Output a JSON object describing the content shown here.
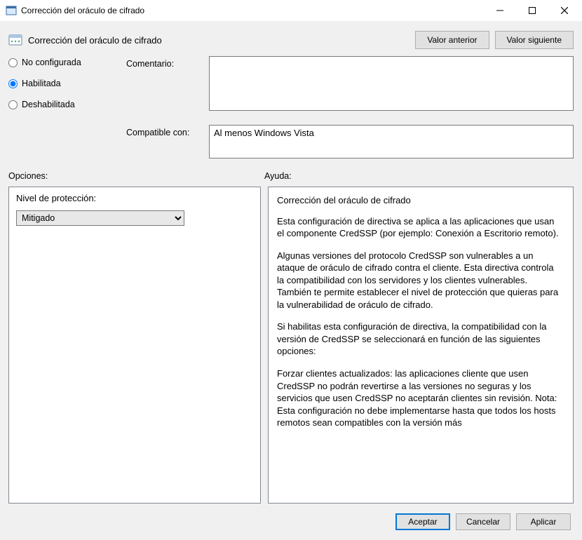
{
  "window": {
    "title": "Corrección del oráculo de cifrado",
    "minimize_icon": "minimize",
    "maximize_icon": "maximize",
    "close_icon": "close"
  },
  "header": {
    "title": "Corrección del oráculo de cifrado",
    "prev_label": "Valor anterior",
    "next_label": "Valor siguiente"
  },
  "state_radios": {
    "not_configured": "No configurada",
    "enabled": "Habilitada",
    "disabled": "Deshabilitada",
    "selected": "enabled"
  },
  "labels": {
    "comment": "Comentario:",
    "compatible": "Compatible con:",
    "options_section": "Opciones:",
    "help_section": "Ayuda:",
    "protection_level": "Nivel de protección:"
  },
  "fields": {
    "comment_value": "",
    "compatible_value": "Al menos Windows Vista"
  },
  "options": {
    "protection_level_value": "Mitigado",
    "protection_level_choices": [
      "Mitigado"
    ]
  },
  "help": {
    "title": "Corrección del oráculo de cifrado",
    "paragraphs": [
      "Esta configuración de directiva se aplica a las aplicaciones que usan el componente CredSSP (por ejemplo: Conexión a Escritorio remoto).",
      "Algunas versiones del protocolo CredSSP son vulnerables a un ataque de oráculo de cifrado contra el cliente. Esta directiva controla la compatibilidad con los servidores y los clientes vulnerables. También te permite establecer el nivel de protección que quieras para la vulnerabilidad de oráculo de cifrado.",
      "Si habilitas esta configuración de directiva, la compatibilidad con la versión de CredSSP se seleccionará en función de las siguientes opciones:",
      "Forzar clientes actualizados: las aplicaciones cliente que usen CredSSP no podrán revertirse a las versiones no seguras y los servicios que usen CredSSP no aceptarán clientes sin revisión. Nota: Esta configuración no debe implementarse hasta que todos los hosts remotos sean compatibles con la versión más"
    ]
  },
  "footer": {
    "ok": "Aceptar",
    "cancel": "Cancelar",
    "apply": "Aplicar"
  }
}
